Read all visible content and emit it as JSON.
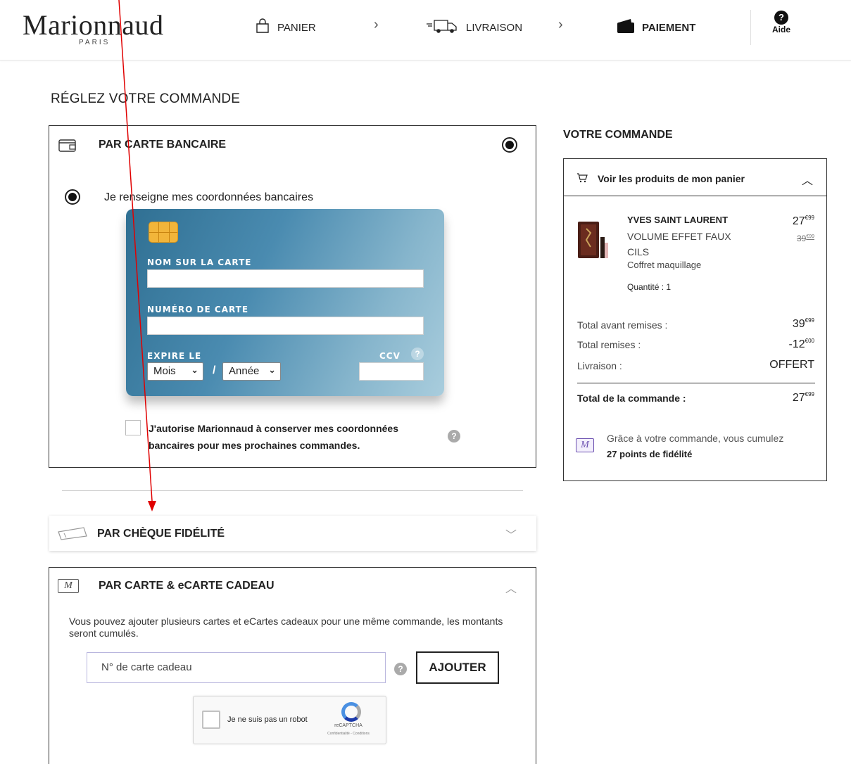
{
  "header": {
    "logo": "Marionnaud",
    "logo_sub": "PARIS",
    "steps": [
      {
        "label": "PANIER",
        "icon": "shopping-bag-icon"
      },
      {
        "label": "LIVRAISON",
        "icon": "delivery-truck-icon"
      },
      {
        "label": "PAIEMENT",
        "icon": "wallet-icon"
      }
    ],
    "help_label": "Aide"
  },
  "page_title": "RÉGLEZ VOTRE COMMANDE",
  "card_payment": {
    "title": "PAR CARTE BANCAIRE",
    "option_label": "Je renseigne mes coordonnées bancaires",
    "name_label": "NOM SUR LA CARTE",
    "number_label": "NUMÉRO DE CARTE",
    "expiry_label": "EXPIRE LE",
    "month_value": "Mois",
    "year_value": "Année",
    "ccv_label": "CCV",
    "ccv_help": "?",
    "consent_text": "J'autorise Marionnaud à conserver mes coordonnées bancaires pour mes prochaines commandes."
  },
  "cheque": {
    "title": "PAR CHÈQUE FIDÉLITÉ"
  },
  "gift_card": {
    "title": "PAR CARTE & eCARTE CADEAU",
    "description": "Vous pouvez ajouter plusieurs cartes et eCartes cadeaux pour une même commande, les montants seront cumulés.",
    "input_placeholder": "N° de carte cadeau",
    "add_button": "AJOUTER",
    "captcha_label": "Je ne suis pas un robot",
    "captcha_brand": "reCAPTCHA",
    "captcha_links": "Confidentialité - Conditions"
  },
  "order": {
    "title": "VOTRE COMMANDE",
    "toggle_label": "Voir les produits de mon panier",
    "product": {
      "brand": "YVES SAINT LAURENT",
      "name": "VOLUME EFFET FAUX CILS",
      "type": "Coffret maquillage",
      "quantity": "Quantité : 1",
      "price_int": "27",
      "price_cents": "€99",
      "old_price_int": "39",
      "old_price_cents": "€99"
    },
    "summary": [
      {
        "label": "Total avant remises :",
        "int": "39",
        "cents": "€99"
      },
      {
        "label": "Total remises :",
        "int": "-12",
        "cents": "€00"
      },
      {
        "label": "Livraison :",
        "int": "OFFERT",
        "cents": ""
      }
    ],
    "total_label": "Total de la commande :",
    "total_int": "27",
    "total_cents": "€99",
    "loyalty_text": "Grâce à votre commande, vous cumulez",
    "loyalty_points": "27 points de fidélité"
  },
  "colors": {
    "card_gradient_start": "#2f6f92",
    "card_gradient_end": "#a9cddd",
    "annotation_arrow": "#e00000",
    "loyalty_purple": "#6b4fb0"
  }
}
